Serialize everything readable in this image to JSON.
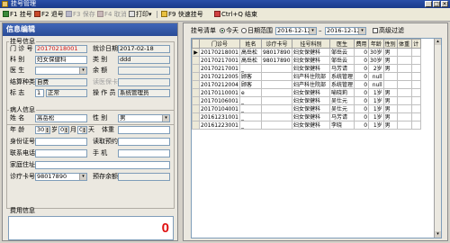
{
  "window": {
    "title": "挂号管理"
  },
  "toolbar": {
    "items": [
      {
        "key": "F1",
        "label": "挂号",
        "enabled": true
      },
      {
        "key": "F2",
        "label": "退号",
        "enabled": true
      },
      {
        "key": "F3",
        "label": "保存",
        "enabled": false
      },
      {
        "key": "F4",
        "label": "取消",
        "enabled": false
      },
      {
        "key": "",
        "label": "打印",
        "enabled": true
      },
      {
        "key": "F9",
        "label": "快速挂号",
        "enabled": true
      },
      {
        "key": "",
        "label": "Ctrl+Q 结束",
        "enabled": true
      }
    ],
    "print_arrow": "▾"
  },
  "left": {
    "header": "信息编辑",
    "reg_group": {
      "title": "挂号信息",
      "clinic_no_label": "门 诊 号",
      "clinic_no_value": "20170218001",
      "visit_date_label": "就诊日期",
      "visit_date_value": "2017-02-18",
      "dept_label": "科    别",
      "dept_value": "妇女保健科",
      "category_label": "类    别",
      "category_value": "ddd",
      "doctor_label": "医    生",
      "doctor_value": "",
      "balance_label": "余    额",
      "balance_value": "",
      "settle_label": "结算种类",
      "settle_value": "自费",
      "card_reader_label": "读医保卡",
      "flag_label": "标    志",
      "flag_code": "1",
      "flag_value": "正常",
      "operator_label": "操 作 员",
      "operator_value": "系统管理员"
    },
    "patient_group": {
      "title": "病人信息",
      "name_label": "姓    名",
      "name_value": "高岳松",
      "sex_label": "性    别",
      "sex_value": "男",
      "age_label": "年    龄",
      "age_years": "30",
      "age_year_unit": "岁",
      "age_months": "0",
      "age_month_unit": "月",
      "age_days": "0",
      "age_day_unit": "天",
      "weight_label": "体重",
      "id_label": "身份证号",
      "id_value": "",
      "appt_label": "读取预约",
      "phone_label": "联系电话",
      "phone_value": "",
      "mobile_label": "手    机",
      "mobile_value": "",
      "address_label": "家庭住址",
      "address_value": "",
      "card_label": "诊疗卡号",
      "card_value": "98017890",
      "prestore_label": "预存余额",
      "prestore_value": ""
    },
    "fee": {
      "title": "费用信息",
      "value": "0"
    }
  },
  "right": {
    "filter_label": "挂号清单",
    "today_label": "今天",
    "range_label": "日期范围",
    "date_from": "2016-12-12",
    "date_sep": "–",
    "date_to": "2016-12-12",
    "advanced_label": "高级过滤",
    "columns": [
      "门诊号",
      "姓名",
      "诊疗卡号",
      "挂号科别",
      "医生",
      "费用",
      "年龄",
      "性别",
      "体重",
      "计"
    ],
    "rows": [
      {
        "mark": "▶",
        "cells": [
          "20170218001",
          "高岳松",
          "98017890",
          "妇女保健科",
          "邹岳云",
          "0",
          "30岁",
          "男",
          "",
          ""
        ]
      },
      {
        "mark": "",
        "cells": [
          "20170217001",
          "高岳松",
          "98017890",
          "妇女保健科",
          "邹岳云",
          "0",
          "30岁",
          "男",
          "",
          ""
        ]
      },
      {
        "mark": "",
        "cells": [
          "20170217001",
          "_",
          "",
          "妇女保健科",
          "马芳请",
          "0",
          "2岁",
          "男",
          "",
          ""
        ]
      },
      {
        "mark": "",
        "cells": [
          "20170212005",
          "顾客",
          "",
          "妇产科住院部",
          "系统管理",
          "0",
          "null",
          "",
          "",
          ""
        ]
      },
      {
        "mark": "",
        "cells": [
          "20170212004",
          "顾客",
          "",
          "妇产科住院部",
          "系统管理",
          "0",
          "null",
          "",
          "",
          ""
        ]
      },
      {
        "mark": "",
        "cells": [
          "20170110001",
          "e",
          "",
          "妇女保健科",
          "喻晓莉",
          "0",
          "1岁",
          "男",
          "",
          ""
        ]
      },
      {
        "mark": "",
        "cells": [
          "20170106001",
          "_",
          "",
          "妇女保健科",
          "吴仕元",
          "0",
          "1岁",
          "男",
          "",
          ""
        ]
      },
      {
        "mark": "",
        "cells": [
          "20170104001",
          "_",
          "",
          "妇女保健科",
          "吴仕元",
          "0",
          "1岁",
          "男",
          "",
          ""
        ]
      },
      {
        "mark": "",
        "cells": [
          "20161231001",
          "_",
          "",
          "妇女保健科",
          "马芳请",
          "0",
          "1岁",
          "男",
          "",
          ""
        ]
      },
      {
        "mark": "",
        "cells": [
          "20161223001",
          "_",
          "",
          "妇女保健科",
          "李晓",
          "0",
          "1岁",
          "男",
          "",
          ""
        ]
      }
    ]
  },
  "icons": {
    "close": "✕",
    "minimize": "_",
    "maximize": "□",
    "dropdown": "▾",
    "scroll_up": "▴",
    "scroll_down": "▾"
  }
}
